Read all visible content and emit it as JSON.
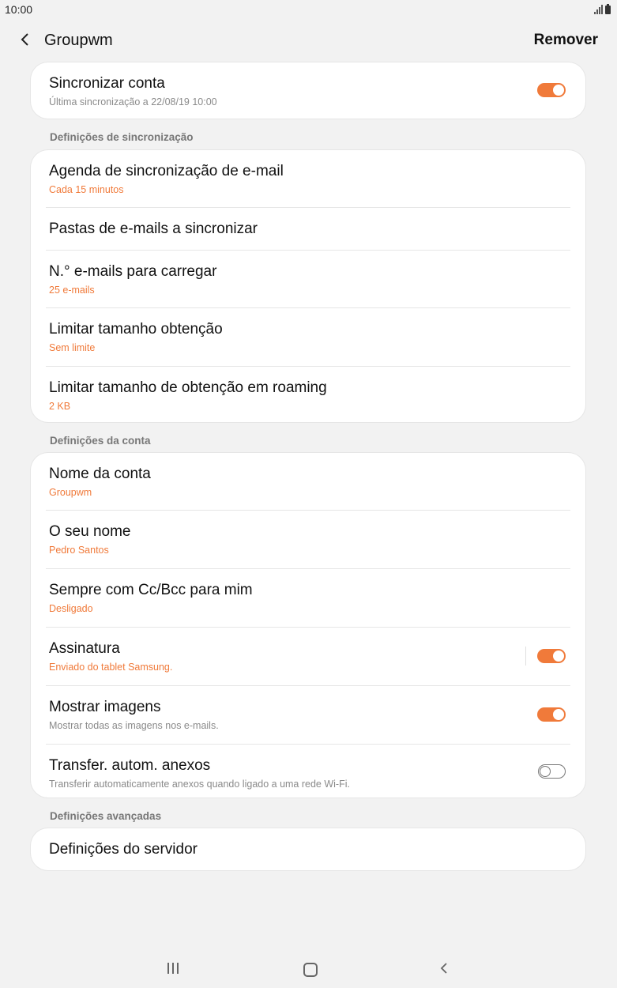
{
  "status_bar": {
    "time": "10:00"
  },
  "header": {
    "title": "Groupwm",
    "remove_label": "Remover",
    "back_icon": "chevron-left-icon"
  },
  "sync_account": {
    "title": "Sincronizar conta",
    "subtitle": "Última sincronização a 22/08/19  10:00",
    "enabled": true
  },
  "sections": {
    "sync_settings": "Definições de sincronização",
    "account_settings": "Definições da conta",
    "advanced_settings": "Definições avançadas"
  },
  "sync_settings": {
    "schedule": {
      "title": "Agenda de sincronização de e-mail",
      "value": "Cada 15 minutos"
    },
    "folders": {
      "title": "Pastas de e-mails a sincronizar"
    },
    "count": {
      "title": "N.° e-mails para carregar",
      "value": "25 e-mails"
    },
    "limit": {
      "title": "Limitar tamanho obtenção",
      "value": "Sem limite"
    },
    "limit_roaming": {
      "title": "Limitar tamanho de obtenção em roaming",
      "value": "2 KB"
    }
  },
  "account_settings": {
    "account_name": {
      "title": "Nome da conta",
      "value": "Groupwm"
    },
    "your_name": {
      "title": "O seu nome",
      "value": "Pedro Santos"
    },
    "always_cc": {
      "title": "Sempre com Cc/Bcc para mim",
      "value": "Desligado"
    },
    "signature": {
      "title": "Assinatura",
      "value": "Enviado do tablet Samsung.",
      "enabled": true
    },
    "show_images": {
      "title": "Mostrar imagens",
      "value": "Mostrar todas as imagens nos e-mails.",
      "enabled": true
    },
    "auto_download": {
      "title": "Transfer. autom. anexos",
      "value": "Transferir automaticamente anexos quando ligado a uma rede Wi-Fi.",
      "enabled": false
    }
  },
  "advanced_settings": {
    "server": {
      "title": "Definições do servidor"
    }
  },
  "colors": {
    "accent": "#f07a3a",
    "background": "#f2f2f2",
    "card": "#ffffff"
  }
}
